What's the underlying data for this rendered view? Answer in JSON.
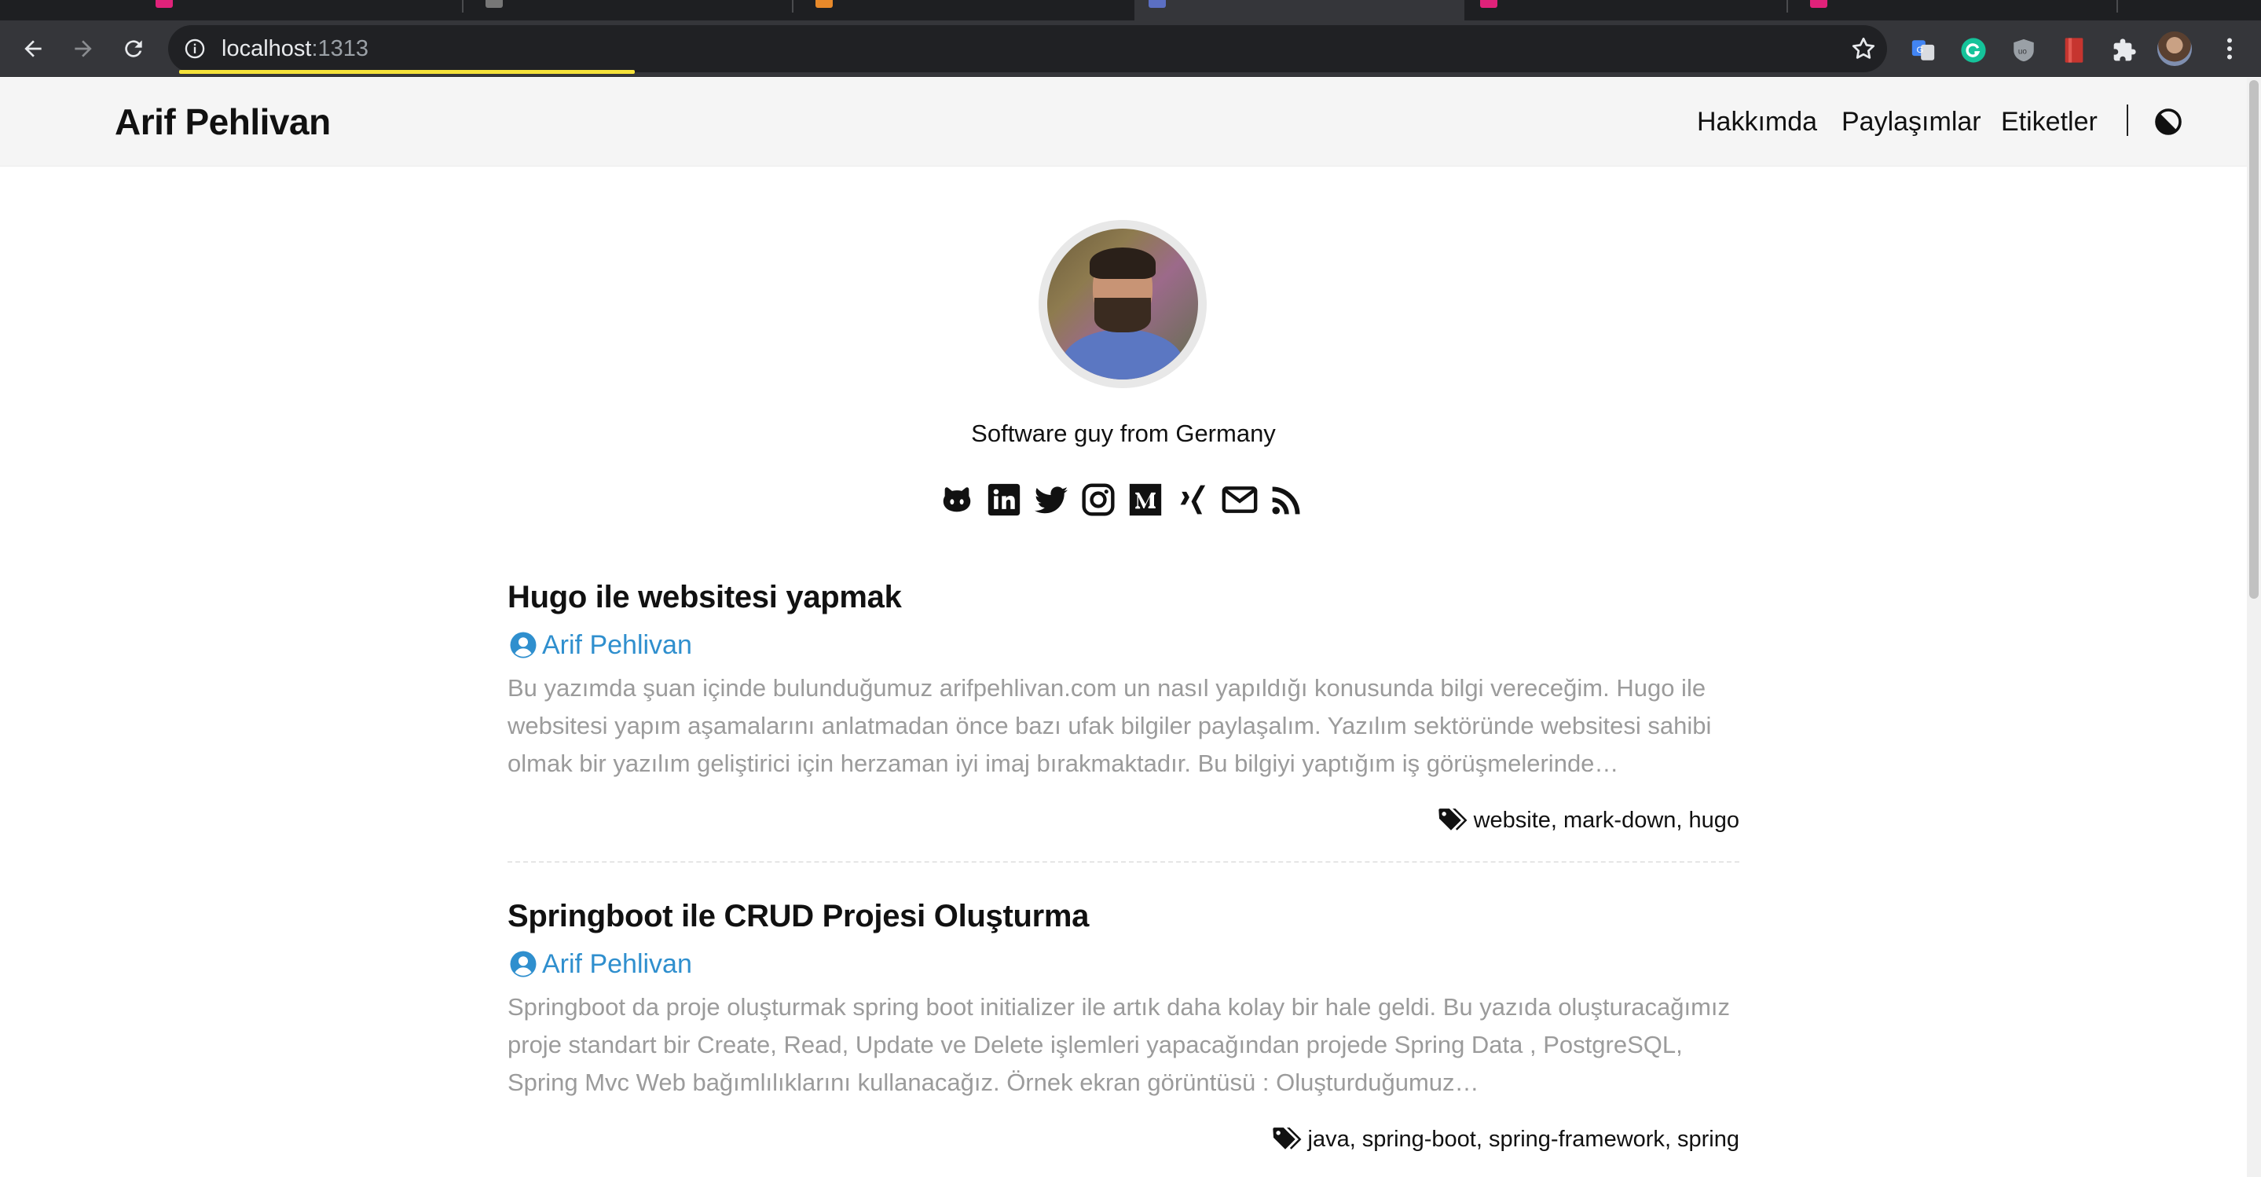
{
  "browser": {
    "url_host": "localhost",
    "url_port": ":1313",
    "tab_favicon_colors": [
      "#e0227a",
      "#777777",
      "#e8892a",
      "#5b6fc2",
      "#e0227a",
      "#e0227a"
    ]
  },
  "site": {
    "brand": "Arif Pehlivan",
    "menu": [
      "Hakkımda",
      "Paylaşımlar",
      "Etiketler"
    ]
  },
  "profile": {
    "tagline": "Software guy from Germany",
    "social_icons": [
      "github-icon",
      "linkedin-icon",
      "twitter-icon",
      "instagram-icon",
      "medium-icon",
      "xing-icon",
      "email-icon",
      "rss-icon"
    ]
  },
  "posts": [
    {
      "title": "Hugo ile websitesi yapmak",
      "author": "Arif Pehlivan",
      "excerpt": "Bu yazımda şuan içinde bulunduğumuz arifpehlivan.com un nasıl yapıldığı konusunda bilgi vereceğim. Hugo ile websitesi yapım aşamalarını anlatmadan önce bazı ufak bilgiler paylaşalım. Yazılım sektöründe websitesi sahibi olmak bir yazılım geliştirici için herzaman iyi imaj bırakmaktadır. Bu bilgiyi yaptığım iş görüşmelerinde…",
      "tags": [
        "website",
        "mark-down",
        "hugo"
      ]
    },
    {
      "title": "Springboot ile CRUD Projesi Oluşturma",
      "author": "Arif Pehlivan",
      "excerpt": "Springboot da proje oluşturmak spring boot initializer ile artık daha kolay bir hale geldi. Bu yazıda oluşturacağımız proje standart bir Create, Read, Update ve Delete işlemleri yapacağından projede Spring Data , PostgreSQL, Spring Mvc Web bağımlılıklarını kullanacağız. Örnek ekran görüntüsü : Oluşturduğumuz…",
      "tags": [
        "java",
        "spring-boot",
        "spring-framework",
        "spring"
      ]
    }
  ],
  "colors": {
    "link": "#2f8fce",
    "excerpt": "#9b9b9b",
    "header_bg": "#f5f5f5"
  }
}
